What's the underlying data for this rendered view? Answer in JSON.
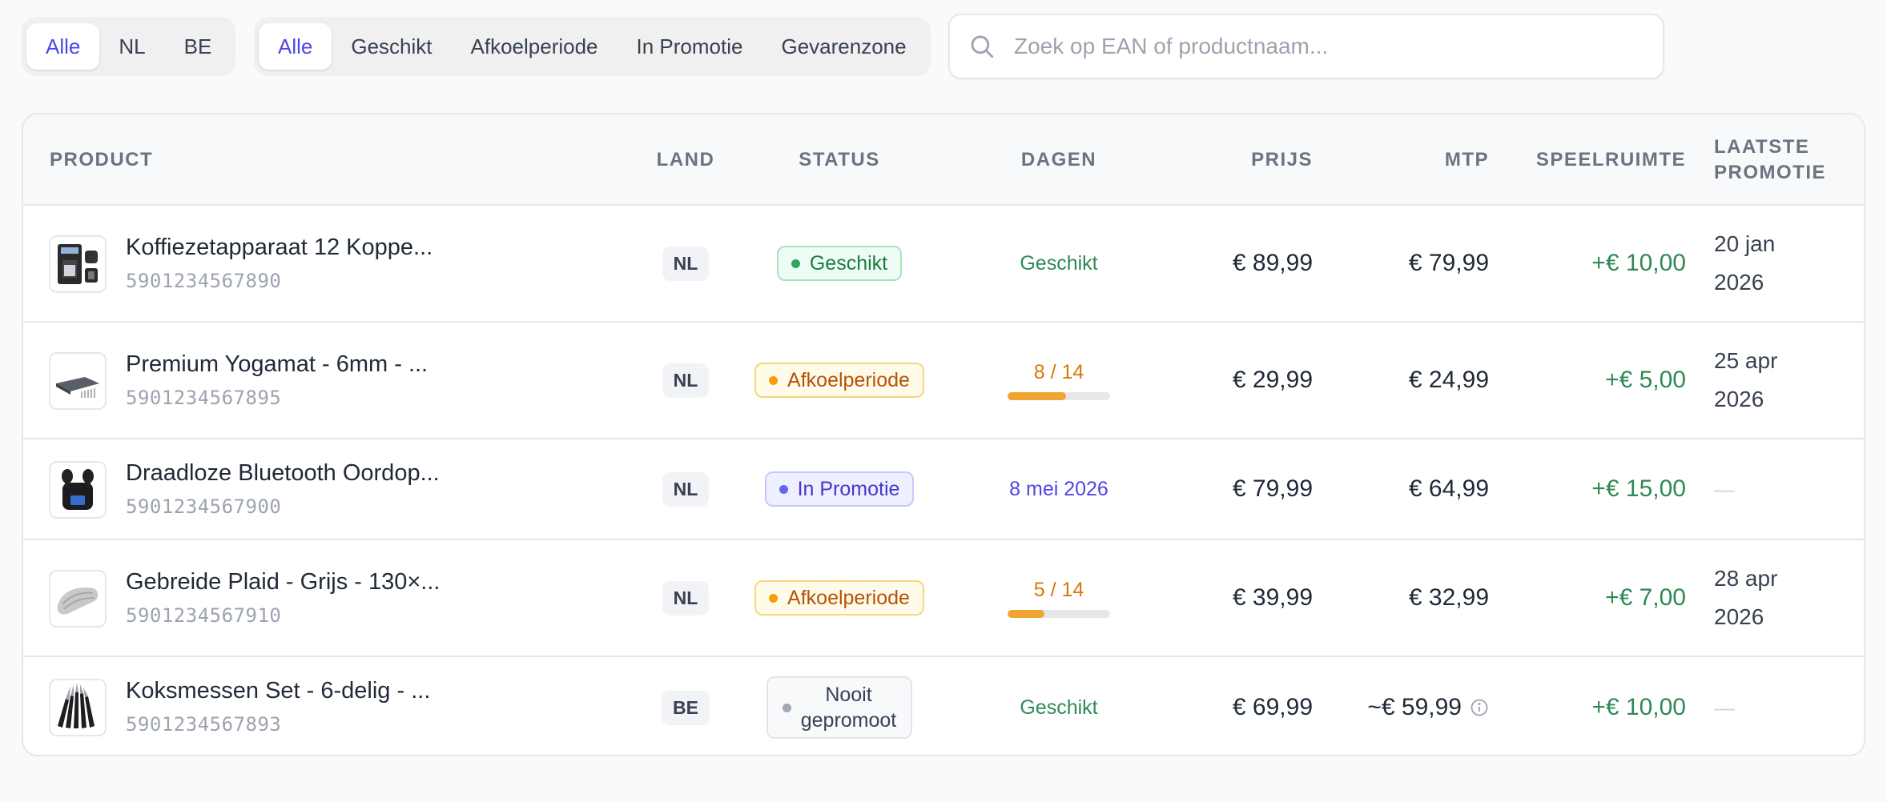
{
  "filters": {
    "country": [
      {
        "label": "Alle",
        "active": true
      },
      {
        "label": "NL",
        "active": false
      },
      {
        "label": "BE",
        "active": false
      }
    ],
    "status": [
      {
        "label": "Alle",
        "active": true
      },
      {
        "label": "Geschikt",
        "active": false
      },
      {
        "label": "Afkoelperiode",
        "active": false
      },
      {
        "label": "In Promotie",
        "active": false
      },
      {
        "label": "Gevarenzone",
        "active": false
      }
    ]
  },
  "search": {
    "placeholder": "Zoek op EAN of productnaam...",
    "value": ""
  },
  "table": {
    "headers": {
      "product": "PRODUCT",
      "land": "LAND",
      "status": "STATUS",
      "dagen": "DAGEN",
      "prijs": "PRIJS",
      "mtp": "MTP",
      "speelruimte": "SPEELRUIMTE",
      "laatste_promotie_1": "LAATSTE",
      "laatste_promotie_2": "PROMOTIE"
    },
    "rows": [
      {
        "name": "Koffiezetapparaat 12 Koppe...",
        "ean": "5901234567890",
        "thumb_icon": "coffee-machine-icon",
        "country": "NL",
        "status": "Geschikt",
        "status_color": "#2fa55d",
        "days": "Geschikt",
        "price": "€ 89,99",
        "mtp": "€ 79,99",
        "margin": "+€ 10,00",
        "last_promo_1": "20 jan",
        "last_promo_2": "2026"
      },
      {
        "name": "Premium Yogamat - 6mm - ...",
        "ean": "5901234567895",
        "thumb_icon": "yoga-mat-icon",
        "country": "NL",
        "status": "Afkoelperiode",
        "status_color": "#f59e0b",
        "days": "8 / 14",
        "days_progress": 0.571,
        "price": "€ 29,99",
        "mtp": "€ 24,99",
        "margin": "+€ 5,00",
        "last_promo_1": "25 apr",
        "last_promo_2": "2026"
      },
      {
        "name": "Draadloze Bluetooth Oordop...",
        "ean": "5901234567900",
        "thumb_icon": "earbuds-icon",
        "country": "NL",
        "status": "In Promotie",
        "status_color": "#6366f1",
        "days": "8 mei 2026",
        "price": "€ 79,99",
        "mtp": "€ 64,99",
        "margin": "+€ 15,00",
        "last_promo": "—"
      },
      {
        "name": "Gebreide Plaid - Grijs - 130×...",
        "ean": "5901234567910",
        "thumb_icon": "blanket-icon",
        "country": "NL",
        "status": "Afkoelperiode",
        "status_color": "#f59e0b",
        "days": "5 / 14",
        "days_progress": 0.357,
        "price": "€ 39,99",
        "mtp": "€ 32,99",
        "margin": "+€ 7,00",
        "last_promo_1": "28 apr",
        "last_promo_2": "2026"
      },
      {
        "name": "Koksmessen Set - 6-delig - ...",
        "ean": "5901234567893",
        "thumb_icon": "knife-set-icon",
        "country": "BE",
        "status_1": "Nooit",
        "status_2": "gepromoot",
        "status_color": "#a1a7b3",
        "days": "Geschikt",
        "price": "€ 69,99",
        "mtp": "~€ 59,99",
        "mtp_info_icon": "info-icon",
        "margin": "+€ 10,00",
        "last_promo": "—"
      }
    ]
  }
}
